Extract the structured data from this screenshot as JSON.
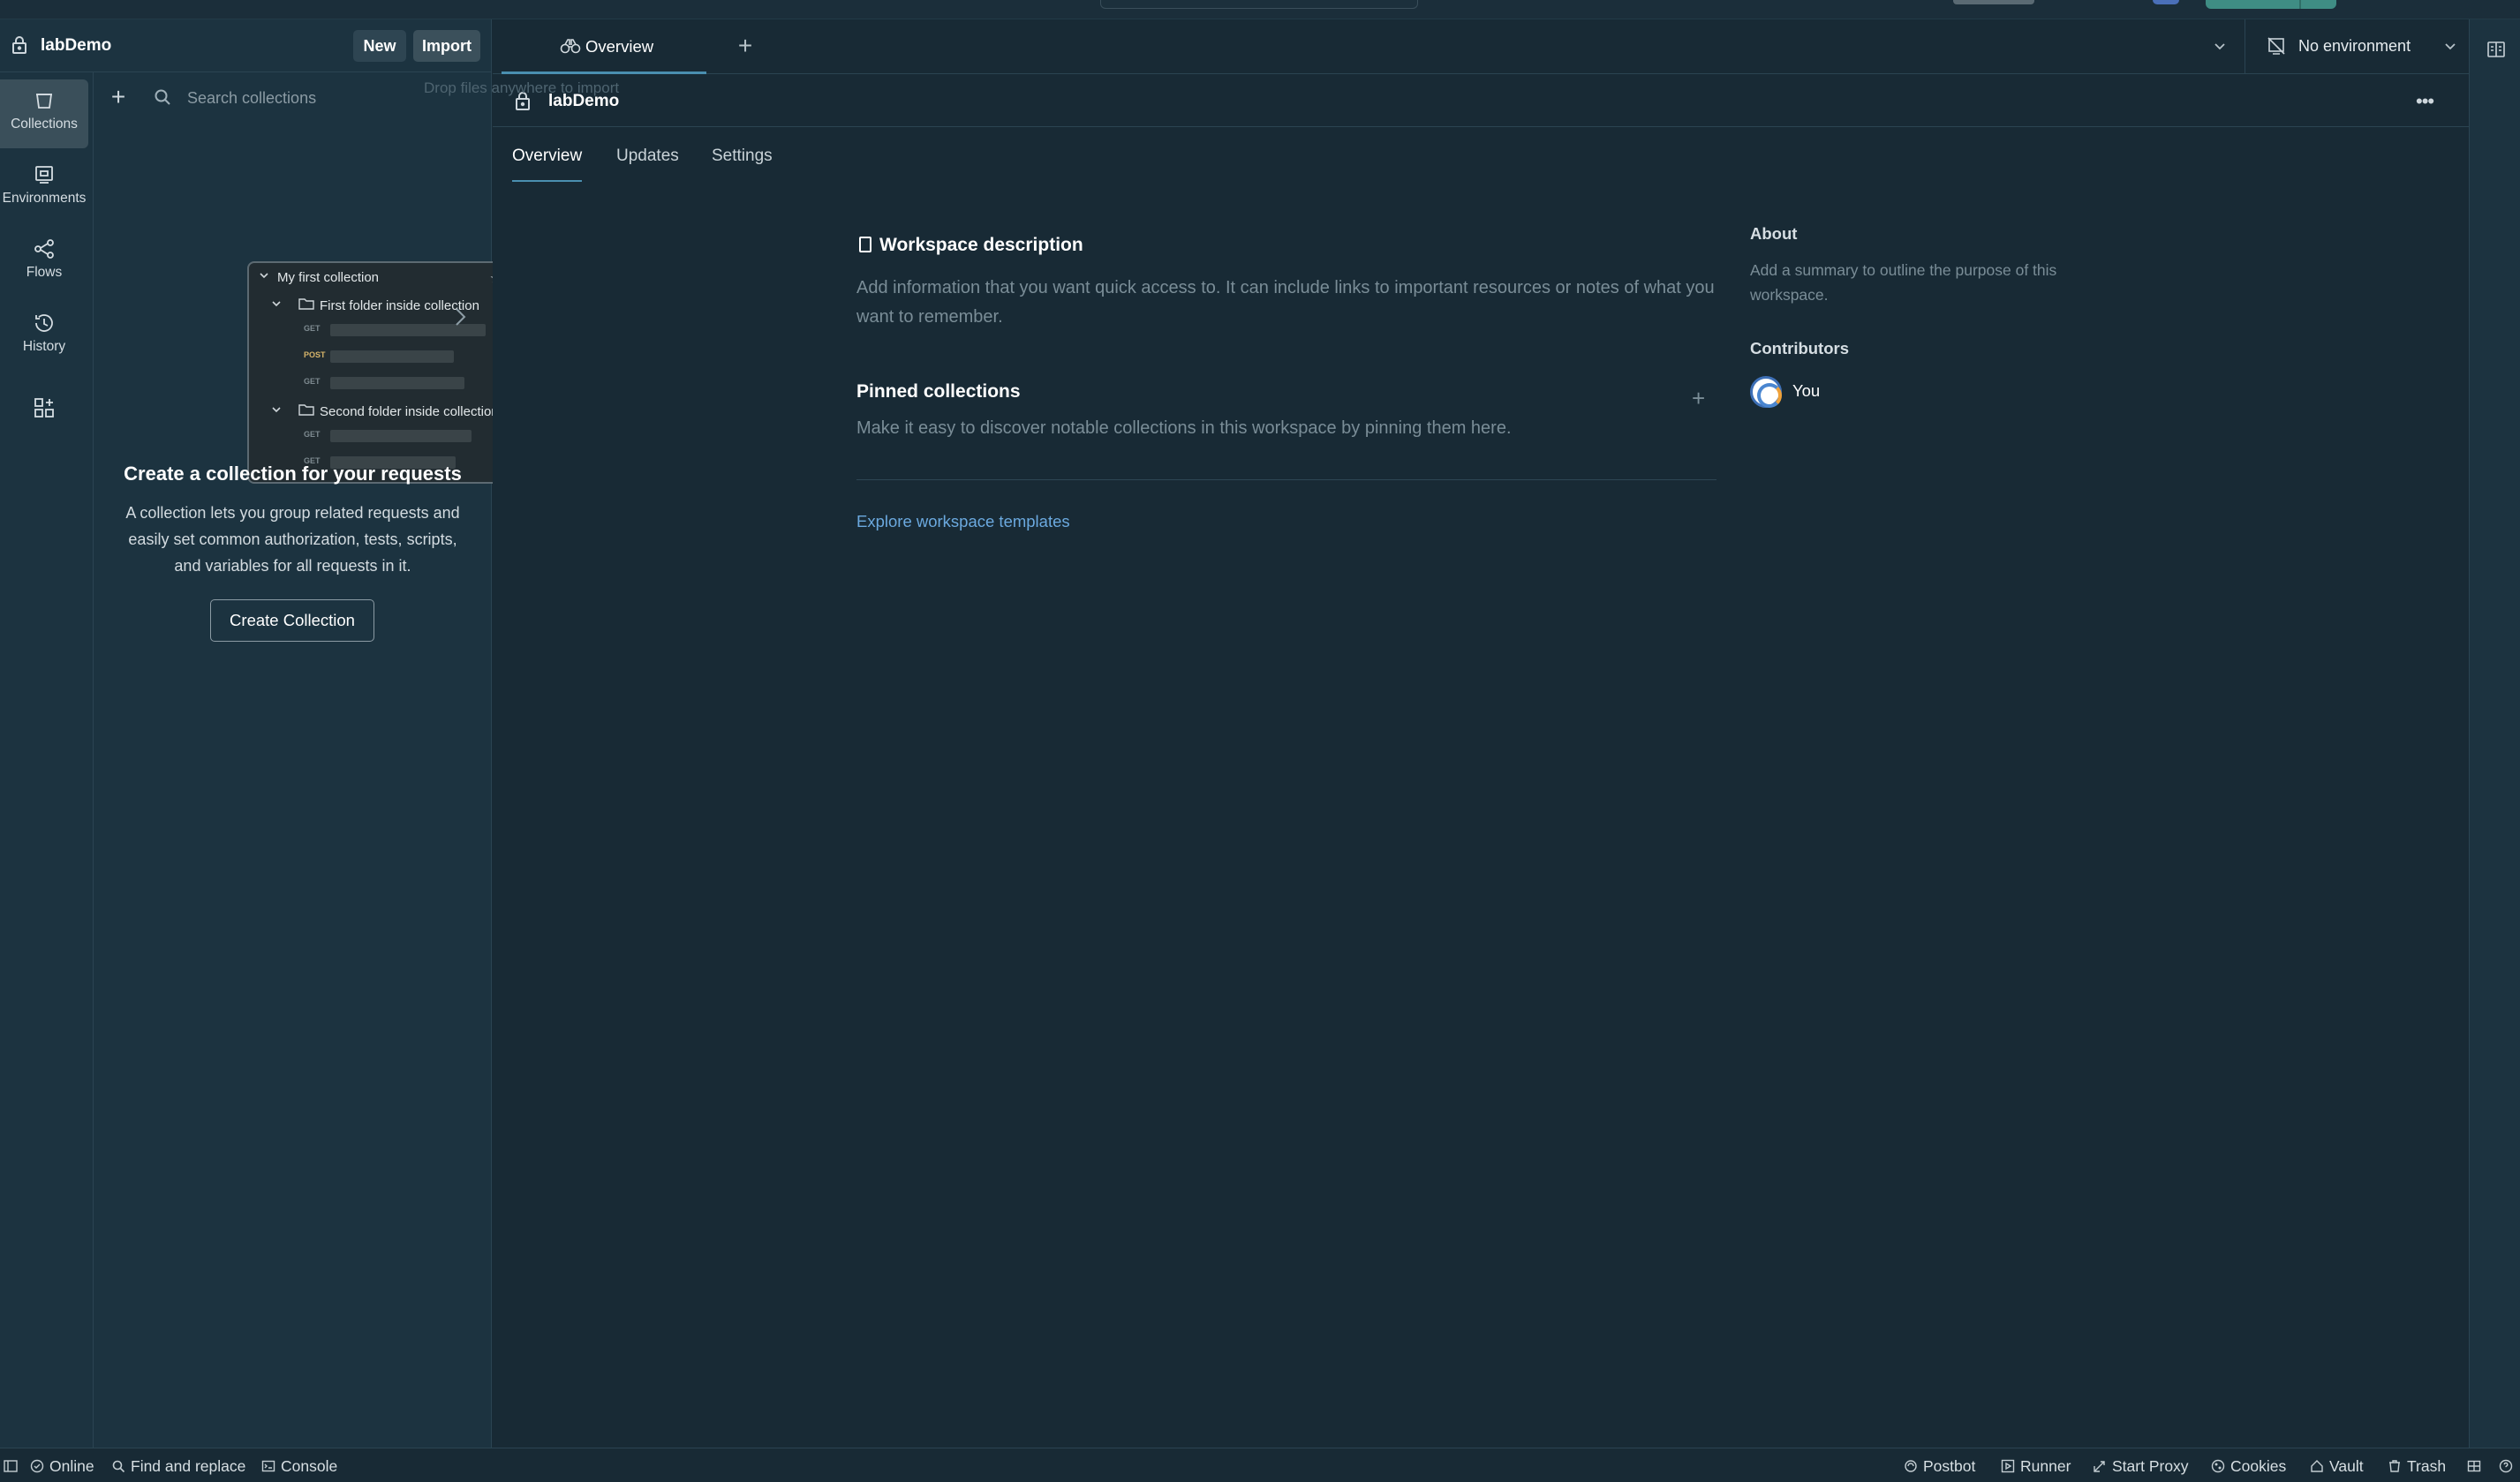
{
  "workspace": {
    "name": "labDemo"
  },
  "left_header": {
    "new_label": "New",
    "import_label": "Import"
  },
  "sidenav": {
    "items": [
      {
        "label": "Collections",
        "icon": "trash-bin-icon"
      },
      {
        "label": "Environments",
        "icon": "environment-icon"
      },
      {
        "label": "Flows",
        "icon": "flows-icon"
      },
      {
        "label": "History",
        "icon": "history-icon"
      },
      {
        "label": "",
        "icon": "add-apps-icon"
      }
    ]
  },
  "collections": {
    "search_placeholder": "Search collections",
    "drop_hint": "Drop files anywhere to import",
    "preview": {
      "collection_name": "My first collection",
      "folder1": "First folder inside collection",
      "folder2": "Second folder inside collection",
      "methods": [
        "GET",
        "POST",
        "GET",
        "GET",
        "GET"
      ]
    },
    "empty_title": "Create a collection for your requests",
    "empty_desc": "A collection lets you group related requests and easily set common authorization, tests, scripts, and variables for all requests in it.",
    "create_button": "Create Collection"
  },
  "tabs": {
    "active_tab": "Overview",
    "environment": "No environment"
  },
  "overview": {
    "subtabs": [
      "Overview",
      "Updates",
      "Settings"
    ],
    "description_title": "Workspace description",
    "description_placeholder": "Add information that you want quick access to. It can include links to important resources or notes of what you want to remember.",
    "pinned_title": "Pinned collections",
    "pinned_placeholder": "Make it easy to discover notable collections in this workspace by pinning them here.",
    "explore_link": "Explore workspace templates",
    "about_title": "About",
    "about_placeholder": "Add a summary to outline the purpose of this workspace.",
    "contributors_title": "Contributors",
    "contributor_name": "You"
  },
  "statusbar": {
    "online": "Online",
    "find_replace": "Find and replace",
    "console": "Console",
    "postbot": "Postbot",
    "runner": "Runner",
    "start_proxy": "Start Proxy",
    "cookies": "Cookies",
    "vault": "Vault",
    "trash": "Trash"
  }
}
